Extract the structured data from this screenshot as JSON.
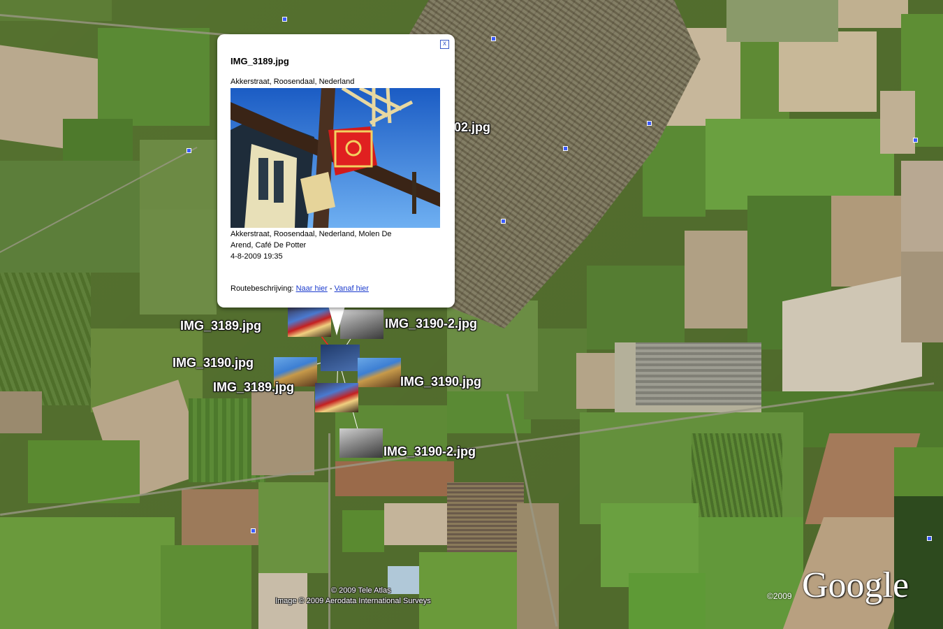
{
  "balloon": {
    "title": "IMG_3189.jpg",
    "address": "Akkerstraat, Roosendaal, Nederland",
    "description_line1": "Akkerstraat, Roosendaal, Nederland, Molen De",
    "description_line2": "Arend, Café De Potter",
    "datetime": "4-8-2009 19:35",
    "route_label": "Routebeschrijving:",
    "route_to": "Naar hier",
    "route_sep": "-",
    "route_from": "Vanaf hier",
    "close_glyph": "x"
  },
  "labels": {
    "l1": "IMG_3189.jpg",
    "l2": "IMG_3190-2.jpg",
    "l3": "IMG_3190.jpg",
    "l4": "IMG_3190.jpg",
    "l5": "IMG_3189.jpg",
    "l6": "IMG_3190-2.jpg",
    "partial": "02.jpg"
  },
  "copyright": {
    "tele_atlas": "© 2009 Tele Atlas",
    "image": "Image © 2009 Aerodata International Surveys",
    "year": "©2009",
    "brand": "Google"
  },
  "colors": {
    "link": "#1a3acd",
    "marker": "#3b5bff",
    "field_green": "#55712f"
  }
}
